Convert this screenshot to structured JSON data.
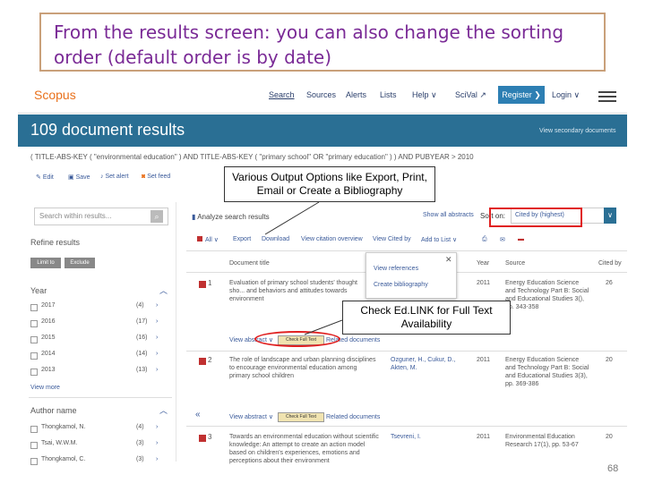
{
  "slide": {
    "title": "From the results screen: you can also change the sorting order (default order is by date)",
    "page_number": "68"
  },
  "topnav": {
    "logo": "Scopus",
    "items": [
      "Search",
      "Sources",
      "Alerts",
      "Lists",
      "Help ∨",
      "SciVal ↗"
    ],
    "register": "Register ❯",
    "login": "Login ∨"
  },
  "banner": {
    "title": "109 document results",
    "link": "View secondary documents"
  },
  "query": "( TITLE-ABS-KEY ( \"environmental education\" ) AND TITLE-ABS-KEY ( \"primary school\" OR \"primary education\" ) ) AND PUBYEAR > 2010",
  "tools": [
    "Edit",
    "Save",
    "Set alert",
    "Set feed"
  ],
  "sidebar": {
    "search_placeholder": "Search within results...",
    "refine": "Refine results",
    "limit": "Limit to",
    "exclude": "Exclude",
    "year_heading": "Year",
    "years": [
      {
        "label": "2017",
        "count": "(4)"
      },
      {
        "label": "2016",
        "count": "(17)"
      },
      {
        "label": "2015",
        "count": "(16)"
      },
      {
        "label": "2014",
        "count": "(14)"
      },
      {
        "label": "2013",
        "count": "(13)"
      }
    ],
    "view_more": "View more",
    "author_heading": "Author name",
    "authors": [
      {
        "label": "Thongkamol, N.",
        "count": "(4)"
      },
      {
        "label": "Tsai, W.W.M.",
        "count": "(3)"
      },
      {
        "label": "Thongkamol, C.",
        "count": "(3)"
      }
    ]
  },
  "results": {
    "analyze": "Analyze search results",
    "show_abstracts": "Show all abstracts",
    "sort_label": "Sort on:",
    "sort_value": "Cited by (highest)",
    "actions": [
      "All ∨",
      "Export",
      "Download",
      "View citation overview",
      "View Cited by",
      "Add to List ∨"
    ],
    "headers": [
      "Document title",
      "Year",
      "Source",
      "Cited by"
    ],
    "popup_items": [
      "View references",
      "Create bibliography"
    ],
    "rows": [
      {
        "num": "1",
        "title": "Evaluation of primary school students' thought sho... and behaviors and attitudes towards environment",
        "authors": "",
        "year": "2011",
        "source": "Energy Education Science and Technology Part B: Social and Educational Studies 3(), pp. 343-358",
        "cited": "26",
        "view_abstract": "View abstract ∨",
        "related": "Related documents"
      },
      {
        "num": "2",
        "title": "The role of landscape and urban planning disciplines to encourage environmental education among primary school children",
        "authors": "Ozguner, H., Cukur, D., Akten, M.",
        "year": "2011",
        "source": "Energy Education Science and Technology Part B: Social and Educational Studies 3(3), pp. 369-386",
        "cited": "20",
        "view_abstract": "View abstract ∨",
        "related": "Related documents"
      },
      {
        "num": "3",
        "title": "Towards an environmental education without scientific knowledge: An attempt to create an action model based on children's experiences, emotions and perceptions about their environment",
        "authors": "Tsevreni, I.",
        "year": "2011",
        "source": "Environmental Education Research 17(1), pp. 53-67",
        "cited": "20",
        "view_abstract": "",
        "related": ""
      }
    ],
    "check_full_text": "Check Full Text"
  },
  "callouts": {
    "output": "Various Output Options like Export, Print, Email or Create a Bibliography",
    "edlink": "Check Ed.LINK for Full Text Availability"
  },
  "colors": {
    "banner": "#2a6f94",
    "title_text": "#7a2a96",
    "highlight": "#e02020"
  }
}
